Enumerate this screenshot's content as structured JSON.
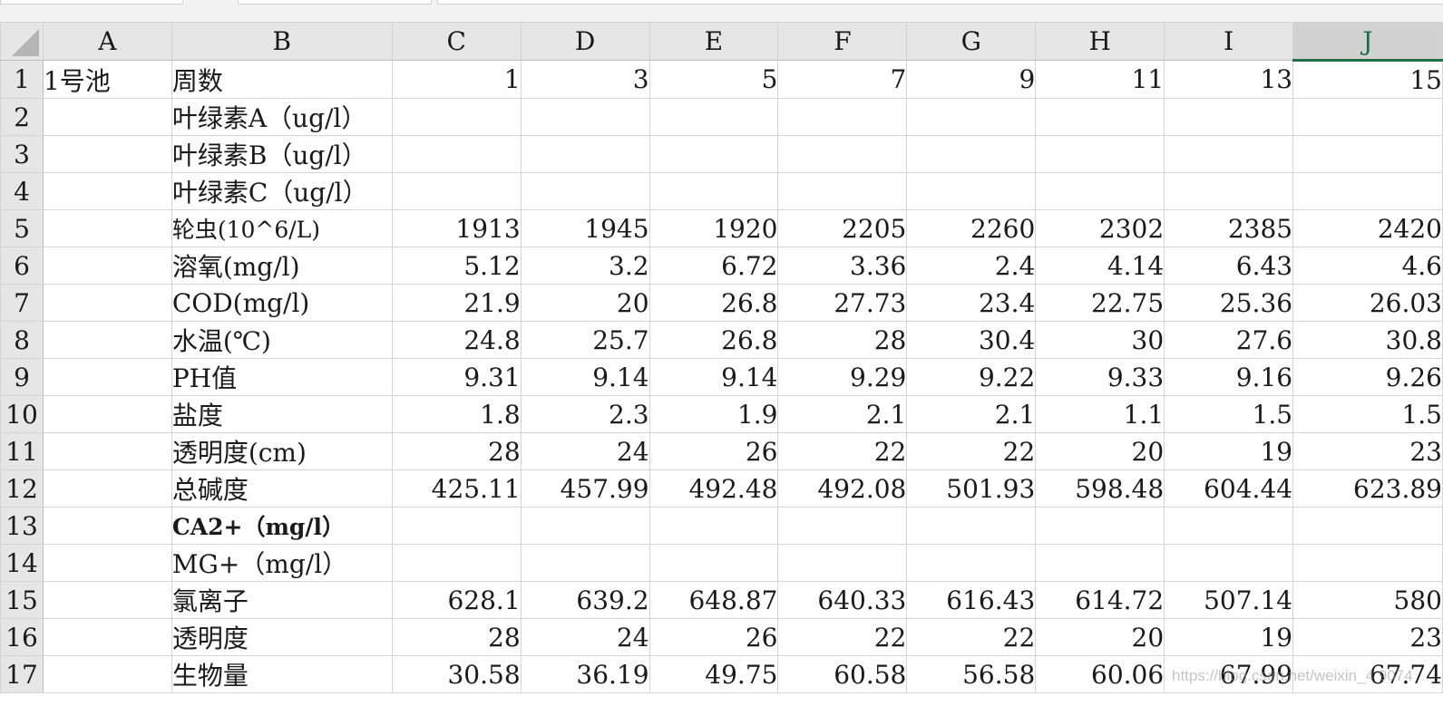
{
  "columns": [
    "A",
    "B",
    "C",
    "D",
    "E",
    "F",
    "G",
    "H",
    "I",
    "J"
  ],
  "selected_column": "J",
  "rows": [
    {
      "n": "1",
      "a": "1号池",
      "b": "周数",
      "v": [
        "1",
        "3",
        "5",
        "7",
        "9",
        "11",
        "13",
        "15"
      ]
    },
    {
      "n": "2",
      "a": "",
      "b": "叶绿素A（ug/l）",
      "v": [
        "",
        "",
        "",
        "",
        "",
        "",
        "",
        ""
      ]
    },
    {
      "n": "3",
      "a": "",
      "b": "叶绿素B（ug/l）",
      "v": [
        "",
        "",
        "",
        "",
        "",
        "",
        "",
        ""
      ]
    },
    {
      "n": "4",
      "a": "",
      "b": "叶绿素C（ug/l）",
      "v": [
        "",
        "",
        "",
        "",
        "",
        "",
        "",
        ""
      ]
    },
    {
      "n": "5",
      "a": "",
      "b": "轮虫(10^6/L)",
      "v": [
        "1913",
        "1945",
        "1920",
        "2205",
        "2260",
        "2302",
        "2385",
        "2420"
      ]
    },
    {
      "n": "6",
      "a": "",
      "b": "溶氧(mg/l)",
      "v": [
        "5.12",
        "3.2",
        "6.72",
        "3.36",
        "2.4",
        "4.14",
        "6.43",
        "4.6"
      ]
    },
    {
      "n": "7",
      "a": "",
      "b": "COD(mg/l)",
      "v": [
        "21.9",
        "20",
        "26.8",
        "27.73",
        "23.4",
        "22.75",
        "25.36",
        "26.03"
      ]
    },
    {
      "n": "8",
      "a": "",
      "b": "水温(℃)",
      "v": [
        "24.8",
        "25.7",
        "26.8",
        "28",
        "30.4",
        "30",
        "27.6",
        "30.8"
      ]
    },
    {
      "n": "9",
      "a": "",
      "b": "PH值",
      "v": [
        "9.31",
        "9.14",
        "9.14",
        "9.29",
        "9.22",
        "9.33",
        "9.16",
        "9.26"
      ]
    },
    {
      "n": "10",
      "a": "",
      "b": "盐度",
      "v": [
        "1.8",
        "2.3",
        "1.9",
        "2.1",
        "2.1",
        "1.1",
        "1.5",
        "1.5"
      ]
    },
    {
      "n": "11",
      "a": "",
      "b": "透明度(cm)",
      "v": [
        "28",
        "24",
        "26",
        "22",
        "22",
        "20",
        "19",
        "23"
      ]
    },
    {
      "n": "12",
      "a": "",
      "b": "总碱度",
      "v": [
        "425.11",
        "457.99",
        "492.48",
        "492.08",
        "501.93",
        "598.48",
        "604.44",
        "623.89"
      ]
    },
    {
      "n": "13",
      "a": "",
      "b": "CA2+（mg/l）",
      "v": [
        "",
        "",
        "",
        "",
        "",
        "",
        "",
        ""
      ]
    },
    {
      "n": "14",
      "a": "",
      "b": "MG+（mg/l）",
      "v": [
        "",
        "",
        "",
        "",
        "",
        "",
        "",
        ""
      ]
    },
    {
      "n": "15",
      "a": "",
      "b": "氯离子",
      "v": [
        "628.1",
        "639.2",
        "648.87",
        "640.33",
        "616.43",
        "614.72",
        "507.14",
        "580"
      ]
    },
    {
      "n": "16",
      "a": "",
      "b": "透明度",
      "v": [
        "28",
        "24",
        "26",
        "22",
        "22",
        "20",
        "19",
        "23"
      ]
    },
    {
      "n": "17",
      "a": "",
      "b": "生物量",
      "v": [
        "30.58",
        "36.19",
        "49.75",
        "60.58",
        "56.58",
        "60.06",
        "67.99",
        "67.74"
      ]
    }
  ],
  "watermark": "https://blog.csdn.net/weixin_4  9074"
}
